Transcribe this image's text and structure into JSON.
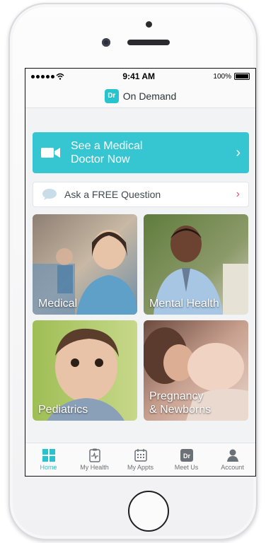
{
  "status_bar": {
    "time": "9:41 AM",
    "battery": "100%"
  },
  "nav": {
    "logo": "Dr",
    "title": "On Demand"
  },
  "primary_cta": {
    "label_line1": "See a Medical",
    "label_line2": "Doctor Now"
  },
  "secondary_cta": {
    "label": "Ask a FREE Question"
  },
  "tiles": [
    {
      "label_line1": "Medical",
      "label_line2": ""
    },
    {
      "label_line1": "Mental Health",
      "label_line2": ""
    },
    {
      "label_line1": "Pediatrics",
      "label_line2": ""
    },
    {
      "label_line1": "Pregnancy",
      "label_line2": "& Newborns"
    }
  ],
  "tab_bar": {
    "items": [
      {
        "label": "Home",
        "icon": "grid-icon",
        "active": true
      },
      {
        "label": "My Health",
        "icon": "health-clipboard-icon",
        "active": false
      },
      {
        "label": "My Appts",
        "icon": "calendar-icon",
        "active": false
      },
      {
        "label": "Meet Us",
        "icon": "dr-badge-icon",
        "active": false,
        "badge": "Dr"
      },
      {
        "label": "Account",
        "icon": "person-icon",
        "active": false
      }
    ]
  },
  "colors": {
    "accent": "#35c6d2",
    "chevron_secondary": "#e2536b"
  }
}
